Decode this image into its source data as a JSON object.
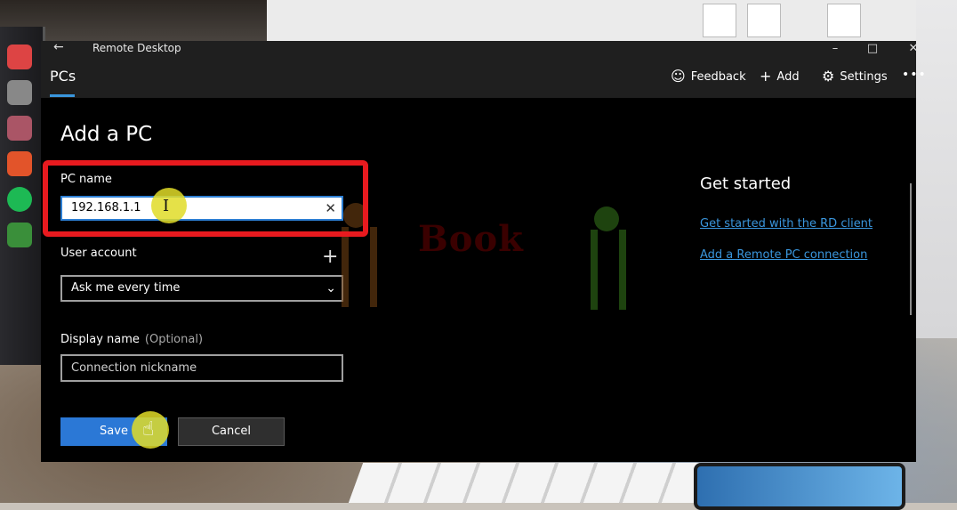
{
  "window": {
    "title": "Remote Desktop",
    "back_icon": "back-arrow-icon",
    "minimize": "–",
    "maximize": "□",
    "close": "✕"
  },
  "appbar": {
    "tab": "PCs",
    "feedback": "Feedback",
    "add": "Add",
    "settings": "Settings",
    "more": "•••"
  },
  "form": {
    "heading": "Add a PC",
    "pc_name_label": "PC name",
    "pc_name_value": "192.168.1.1",
    "user_account_label": "User account",
    "user_account_value": "Ask me every time",
    "display_name_label": "Display name",
    "display_name_optional": "(Optional)",
    "display_name_placeholder": "Connection nickname",
    "save": "Save",
    "cancel": "Cancel"
  },
  "get_started": {
    "title": "Get started",
    "link1": "Get started with the RD client",
    "link2": "Add a Remote PC connection"
  },
  "watermark": {
    "text": "Book"
  },
  "colors": {
    "accent": "#2b78d6",
    "link": "#3a96dd",
    "highlight": "#e81a1f"
  }
}
